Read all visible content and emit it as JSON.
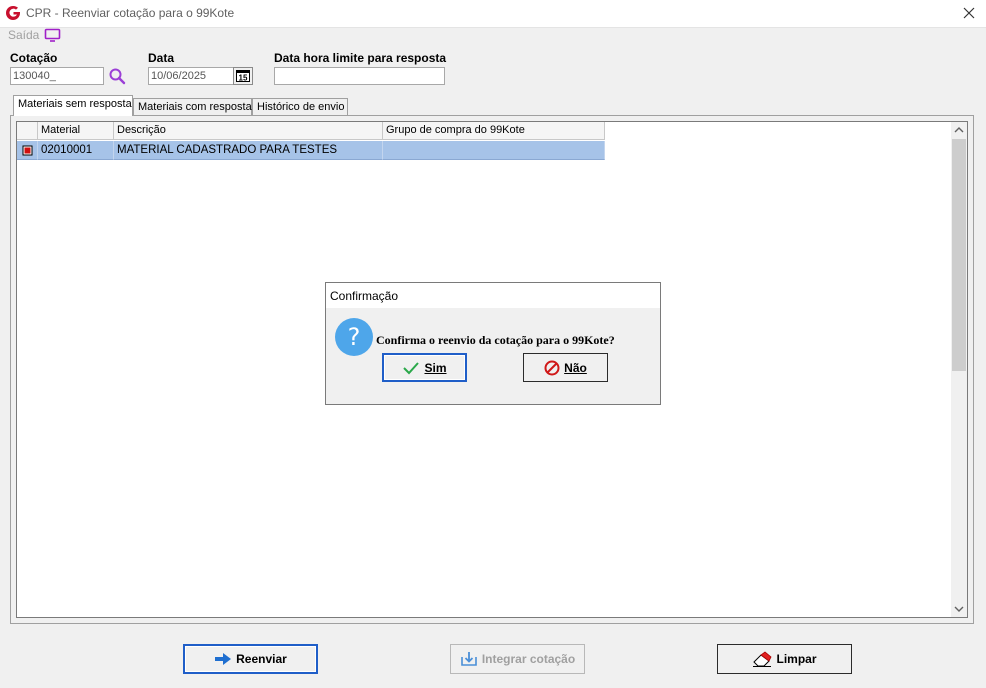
{
  "window": {
    "title": "CPR - Reenviar cotação para o 99Kote"
  },
  "menu": {
    "saida_label": "Saída"
  },
  "form": {
    "cotacao_label": "Cotação",
    "cotacao_value": "130040_",
    "data_label": "Data",
    "data_value": "10/06/2025",
    "calendar_glyph": "15",
    "limite_label": "Data hora limite para resposta",
    "limite_value": ""
  },
  "tabs": [
    {
      "label": "Materiais sem resposta",
      "active": true
    },
    {
      "label": "Materiais com resposta",
      "active": false
    },
    {
      "label": "Histórico de envio",
      "active": false
    }
  ],
  "grid": {
    "columns": [
      "Material",
      "Descrição",
      "Grupo de compra do 99Kote"
    ],
    "rows": [
      {
        "material": "02010001",
        "descricao": "MATERIAL CADASTRADO PARA TESTES",
        "grupo": ""
      }
    ]
  },
  "dialog": {
    "title": "Confirmação",
    "message": "Confirma o reenvio da cotação para o 99Kote?",
    "yes_label": "Sim",
    "no_label": "Não"
  },
  "footer": {
    "reenviar_label": "Reenviar",
    "integrar_label": "Integrar cotação",
    "limpar_label": "Limpar"
  },
  "colors": {
    "row_selected": "#a6c3e8",
    "accent": "#1f5ec8",
    "logo_red": "#c8102e"
  }
}
